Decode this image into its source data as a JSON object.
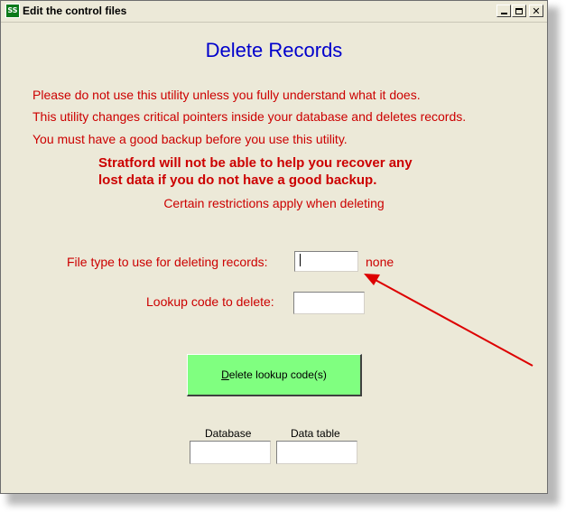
{
  "window": {
    "icon_text": "SS",
    "title": "Edit the control files",
    "minimize_label": "_",
    "close_label": "✕"
  },
  "heading": "Delete Records",
  "warnings": [
    "Please do not use this utility unless you fully understand what it does.",
    "This utility changes critical pointers inside your database and deletes records.",
    "You must have a good backup before you use this utility."
  ],
  "bold_warnings": [
    "Stratford will not be able to help you recover any",
    "lost data if you do not have a good backup."
  ],
  "restrictions": "Certain restrictions apply when deleting",
  "file_type": {
    "label": "File type to use for deleting records:",
    "value": "",
    "status": "none"
  },
  "lookup_code": {
    "label": "Lookup code to delete:",
    "value": ""
  },
  "delete_button": {
    "accel": "D",
    "rest": "elete lookup code(s)"
  },
  "database": {
    "label": "Database",
    "value": ""
  },
  "data_table": {
    "label": "Data table",
    "value": ""
  },
  "colors": {
    "heading": "#0000cc",
    "warning": "#cc0000",
    "button_bg": "#80ff80",
    "window_bg": "#ece9d8",
    "annotation_arrow": "#dd0000"
  }
}
